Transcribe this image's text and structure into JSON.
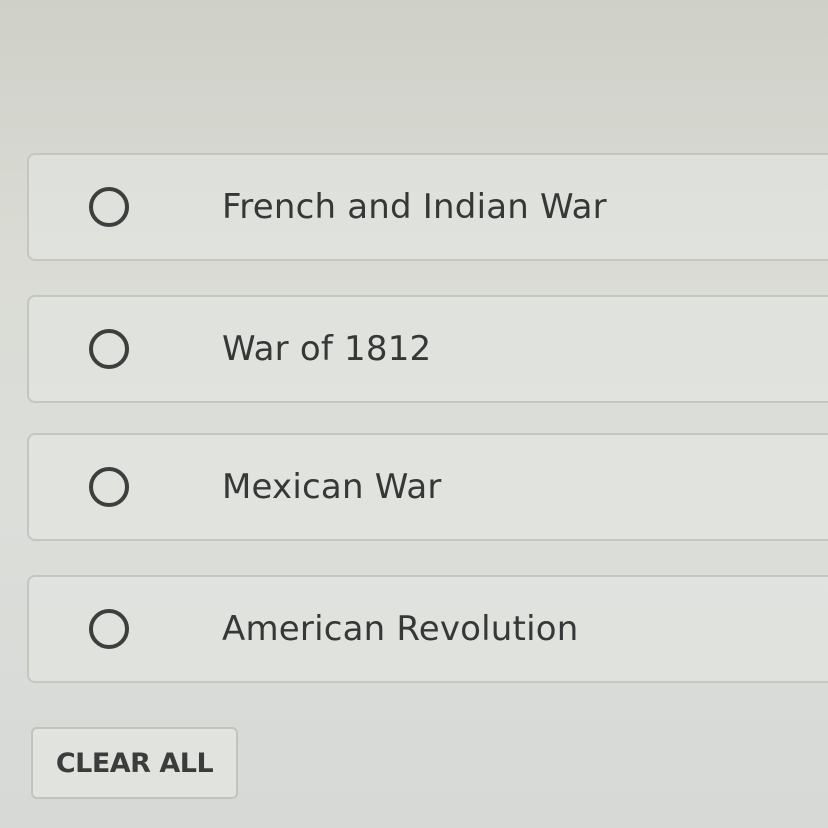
{
  "question": {
    "options": [
      {
        "label": "French and Indian War",
        "selected": false
      },
      {
        "label": "War of 1812",
        "selected": false
      },
      {
        "label": "Mexican War",
        "selected": false
      },
      {
        "label": "American Revolution",
        "selected": false
      }
    ]
  },
  "actions": {
    "clear_all_label": "CLEAR ALL"
  },
  "colors": {
    "background": "#d8dad4",
    "option_border": "#c4c7c0",
    "text": "#353836",
    "radio_stroke": "#3c3f3d"
  }
}
